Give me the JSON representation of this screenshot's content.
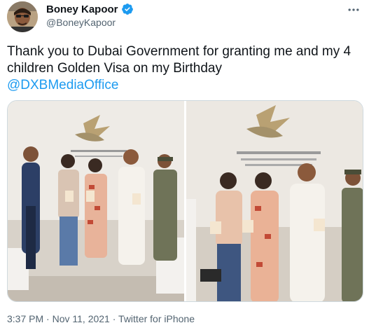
{
  "author": {
    "name": "Boney Kapoor",
    "handle": "@BoneyKapoor",
    "verified": true
  },
  "tweet": {
    "text": "Thank you to Dubai Government for granting me and my 4 children Golden Visa on my Birthday",
    "mention": "@DXBMediaOffice"
  },
  "media": {
    "count": 2
  },
  "meta": {
    "time": "3:37 PM",
    "separator": " · ",
    "date": "Nov 11, 2021",
    "source": "Twitter for iPhone"
  },
  "icons": {
    "verified": "verified-badge-icon",
    "more": "more-options-icon"
  },
  "colors": {
    "link": "#1d9bf0",
    "secondary_text": "#536471",
    "verified": "#1d9bf0"
  }
}
